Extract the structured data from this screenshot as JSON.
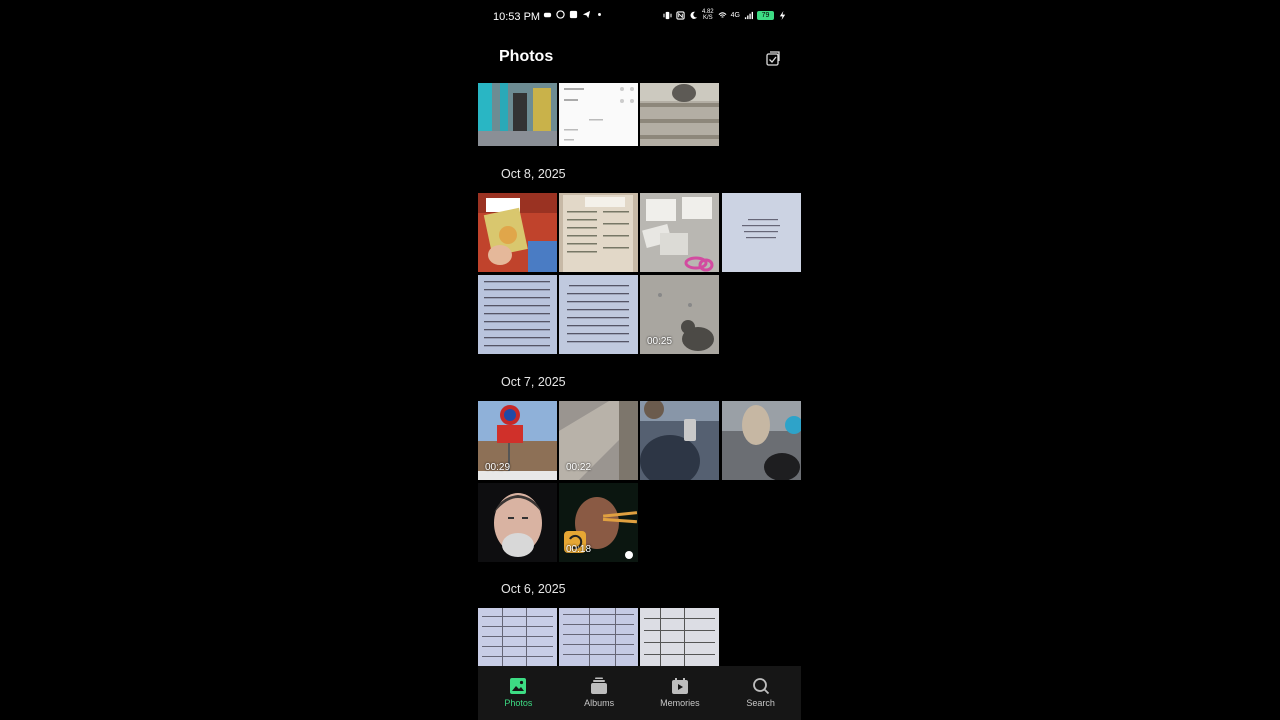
{
  "status_bar": {
    "time": "10:53 PM",
    "network_speed": "4.82",
    "network_unit": "K/S",
    "network_type": "4G",
    "battery": "79"
  },
  "header": {
    "title": "Photos"
  },
  "groups": [
    {
      "date": "",
      "items": [
        {
          "duration": ""
        },
        {
          "duration": ""
        },
        {
          "duration": ""
        }
      ]
    },
    {
      "date": "Oct 8, 2025",
      "items": [
        {
          "duration": ""
        },
        {
          "duration": ""
        },
        {
          "duration": ""
        },
        {
          "duration": ""
        },
        {
          "duration": ""
        },
        {
          "duration": ""
        },
        {
          "duration": "00:25"
        }
      ]
    },
    {
      "date": "Oct 7, 2025",
      "items": [
        {
          "duration": "00:29"
        },
        {
          "duration": "00:22"
        },
        {
          "duration": ""
        },
        {
          "duration": ""
        },
        {
          "duration": ""
        },
        {
          "duration": "00:18"
        }
      ]
    },
    {
      "date": "Oct 6, 2025",
      "items": [
        {
          "duration": ""
        },
        {
          "duration": ""
        },
        {
          "duration": ""
        }
      ]
    }
  ],
  "bottom_nav": [
    {
      "label": "Photos",
      "icon": "photos-icon",
      "active": true
    },
    {
      "label": "Albums",
      "icon": "albums-icon",
      "active": false
    },
    {
      "label": "Memories",
      "icon": "memories-icon",
      "active": false
    },
    {
      "label": "Search",
      "icon": "search-icon",
      "active": false
    }
  ],
  "colors": {
    "accent": "#3ddc84",
    "background": "#000000",
    "nav_background": "#161616"
  }
}
